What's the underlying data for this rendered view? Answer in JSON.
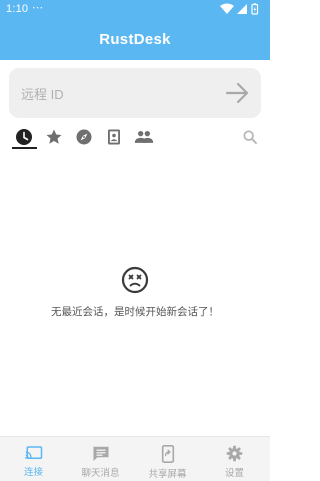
{
  "status_bar": {
    "time": "1:10",
    "notification_dots": "⋯"
  },
  "app_bar": {
    "title": "RustDesk"
  },
  "remote_id": {
    "placeholder": "远程 ID",
    "value": ""
  },
  "tabs": [
    {
      "name": "recent",
      "icon": "clock-icon",
      "active": true
    },
    {
      "name": "favorites",
      "icon": "star-icon",
      "active": false
    },
    {
      "name": "discovered",
      "icon": "compass-icon",
      "active": false
    },
    {
      "name": "address-book",
      "icon": "contact-book-icon",
      "active": false
    },
    {
      "name": "group",
      "icon": "people-icon",
      "active": false
    }
  ],
  "empty_state": {
    "icon": "sad-face-icon",
    "message": "无最近会话，是时候开始新会话了！"
  },
  "bottom_nav": [
    {
      "label": "连接",
      "icon": "cast-icon",
      "active": true
    },
    {
      "label": "聊天消息",
      "icon": "chat-icon",
      "active": false
    },
    {
      "label": "共享屏幕",
      "icon": "mobile-share-icon",
      "active": false
    },
    {
      "label": "设置",
      "icon": "gear-icon",
      "active": false
    }
  ],
  "colors": {
    "primary": "#5ab7f2",
    "inactive_icon": "#a8a8a8",
    "tab_icon": "#6f6f6f",
    "active_tab": "#222222"
  }
}
